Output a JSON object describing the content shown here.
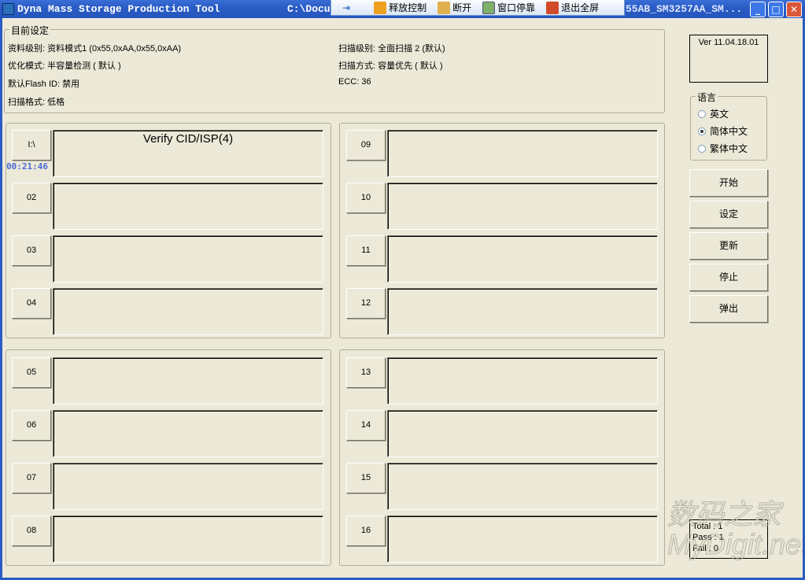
{
  "window": {
    "title": "Dyna Mass Storage Production Tool",
    "path": "C:\\Docu",
    "title_tail": "55AB_SM3257AA_SM...",
    "min": "_",
    "max": "□",
    "close": "✕"
  },
  "toolbar": {
    "pin": "⇥",
    "release": "释放控制",
    "disconnect": "断开",
    "dock": "窗口停靠",
    "exit_full": "退出全屏"
  },
  "settings": {
    "title": "目前设定",
    "data_level": "资料级别: 资料模式1 (0x55,0xAA,0x55,0xAA)",
    "optimize": "优化模式: 半容量检测 ( 默认 )",
    "flash_id": "默认Flash ID: 禁用",
    "scan_format": "扫描格式: 低格",
    "scan_level": "扫描级别: 全面扫描 2 (默认)",
    "scan_mode": "扫描方式: 容量优先 ( 默认 )",
    "ecc": "ECC: 36"
  },
  "version": "Ver 11.04.18.01",
  "language": {
    "title": "语言",
    "options": [
      "英文",
      "简体中文",
      "繁体中文"
    ],
    "selected": 1
  },
  "buttons": [
    "开始",
    "设定",
    "更新",
    "停止",
    "弹出"
  ],
  "slots": [
    {
      "label": "I:\\",
      "status": "Verify CID/ISP(4)",
      "time": "00:21:46"
    },
    {
      "label": "02"
    },
    {
      "label": "03"
    },
    {
      "label": "04"
    },
    {
      "label": "05"
    },
    {
      "label": "06"
    },
    {
      "label": "07"
    },
    {
      "label": "08"
    },
    {
      "label": "09"
    },
    {
      "label": "10"
    },
    {
      "label": "11"
    },
    {
      "label": "12"
    },
    {
      "label": "13"
    },
    {
      "label": "14"
    },
    {
      "label": "15"
    },
    {
      "label": "16"
    }
  ],
  "stats": {
    "total": "Total : 1",
    "pass": "Pass : 1",
    "fail": "Fail : 0"
  },
  "watermark": "数码之家 MyDigit.net"
}
